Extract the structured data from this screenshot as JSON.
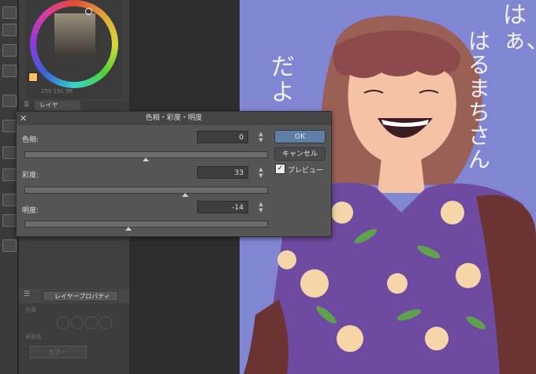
{
  "color_panel": {
    "r": "255",
    "g": "191",
    "b": "99"
  },
  "dialog": {
    "title": "色相・彩度・明度",
    "close_glyph": "✕",
    "hue": {
      "label": "色相:",
      "value": "0",
      "level": 0.5
    },
    "saturation": {
      "label": "彩度:",
      "value": "33",
      "level": 0.665
    },
    "lightness": {
      "label": "明度:",
      "value": "-14",
      "level": 0.43
    },
    "ok_label": "OK",
    "cancel_label": "キャンセル",
    "preview_label": "プレビュー",
    "preview_checked": true
  },
  "layer_panel": {
    "tab_label": "レイヤ",
    "property_tab_label": "レイヤープロパティ",
    "effect_label": "効果",
    "display_color_label": "表現色",
    "color_value": "カラー"
  },
  "canvas": {
    "text_col1": "はぁ、",
    "text_col2": "はるまちさん",
    "text_col3": "だよ",
    "bg_color": "#8186d3"
  },
  "icons": [
    "close-icon",
    "checkmark-icon",
    "spin-up-icon",
    "spin-down-icon",
    "layer-icon",
    "menu-icon"
  ]
}
